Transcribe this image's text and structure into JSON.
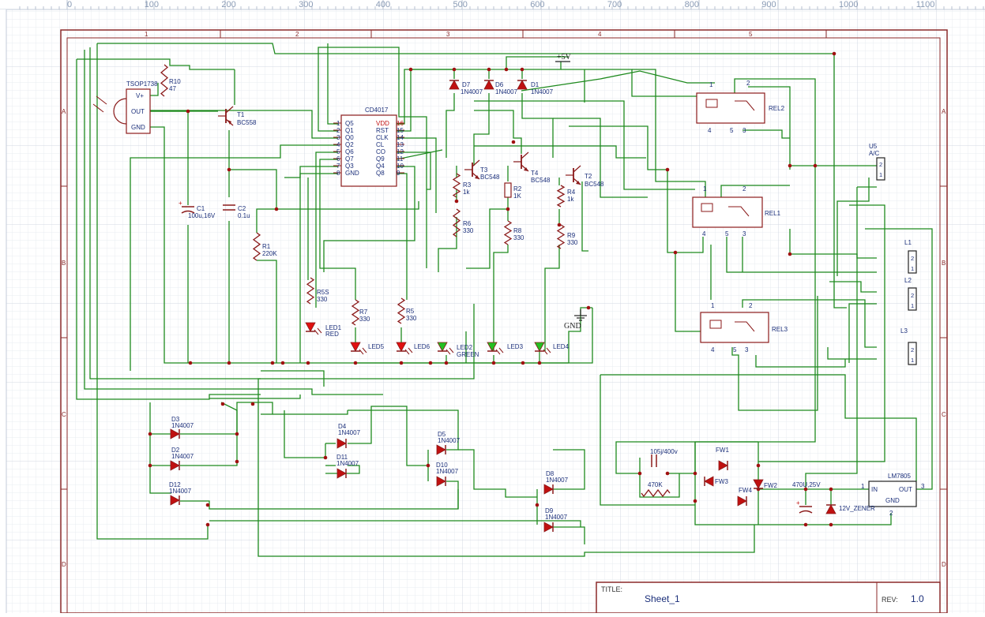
{
  "ruler": {
    "ticks": [
      "0",
      "100",
      "200",
      "300",
      "400",
      "500",
      "600",
      "700",
      "800",
      "900",
      "1000",
      "1100"
    ]
  },
  "frame": {
    "columns": [
      "1",
      "2",
      "3",
      "4",
      "5"
    ],
    "rows": [
      "A",
      "B",
      "C",
      "D"
    ]
  },
  "title_block": {
    "title_label": "TITLE:",
    "title_value": "Sheet_1",
    "rev_label": "REV:",
    "rev_value": "1.0"
  },
  "ic": {
    "name": "CD4017",
    "left_pins": [
      {
        "num": "1",
        "name": "Q5"
      },
      {
        "num": "2",
        "name": "Q1"
      },
      {
        "num": "3",
        "name": "Q0"
      },
      {
        "num": "4",
        "name": "Q2"
      },
      {
        "num": "5",
        "name": "Q6"
      },
      {
        "num": "6",
        "name": "Q7"
      },
      {
        "num": "7",
        "name": "Q3"
      },
      {
        "num": "8",
        "name": "GND"
      }
    ],
    "right_pins": [
      {
        "num": "16",
        "name": "VDD"
      },
      {
        "num": "15",
        "name": "RST"
      },
      {
        "num": "14",
        "name": "CLK"
      },
      {
        "num": "13",
        "name": "CL"
      },
      {
        "num": "12",
        "name": "CO"
      },
      {
        "num": "11",
        "name": "Q9"
      },
      {
        "num": "10",
        "name": "Q4"
      },
      {
        "num": "9",
        "name": "Q8"
      }
    ]
  },
  "tsop": {
    "name": "TSOP1738",
    "pins": [
      "V+",
      "OUT",
      "GND"
    ]
  },
  "regulator": {
    "name": "LM7805",
    "in_label": "IN",
    "out_label": "OUT",
    "gnd_label": "GND",
    "pin_in": "1",
    "pin_out": "3",
    "pin_gnd": "2"
  },
  "connectors": [
    {
      "ref": "U5",
      "sub": "A/C",
      "pins": [
        "2",
        "1"
      ]
    },
    {
      "ref": "L1",
      "sub": "",
      "pins": [
        "2",
        "1"
      ]
    },
    {
      "ref": "L2",
      "sub": "",
      "pins": [
        "2",
        "1"
      ]
    },
    {
      "ref": "L3",
      "sub": "",
      "pins": [
        "2",
        "1"
      ]
    }
  ],
  "relays": [
    {
      "ref": "REL2",
      "pins": [
        "1",
        "2",
        "4",
        "5",
        "3"
      ]
    },
    {
      "ref": "REL1",
      "pins": [
        "1",
        "2",
        "4",
        "5",
        "3"
      ]
    },
    {
      "ref": "REL3",
      "pins": [
        "1",
        "2",
        "4",
        "5",
        "3"
      ]
    }
  ],
  "transistors": [
    {
      "ref": "T1",
      "part": "BC558"
    },
    {
      "ref": "T3",
      "part": "BC548"
    },
    {
      "ref": "T4",
      "part": "BC548"
    },
    {
      "ref": "T2",
      "part": "BC548"
    }
  ],
  "resistors": [
    {
      "ref": "R10",
      "val": "47"
    },
    {
      "ref": "R1",
      "val": "220K"
    },
    {
      "ref": "R3",
      "val": "1k"
    },
    {
      "ref": "R6",
      "val": "330"
    },
    {
      "ref": "R2",
      "val": "1K"
    },
    {
      "ref": "R8",
      "val": "330"
    },
    {
      "ref": "R4",
      "val": "1k"
    },
    {
      "ref": "R9",
      "val": "330"
    },
    {
      "ref": "R5S",
      "val": "330"
    },
    {
      "ref": "R7",
      "val": "330"
    },
    {
      "ref": "R5",
      "val": "330"
    },
    {
      "ref": "",
      "val": "470K"
    }
  ],
  "capacitors": [
    {
      "ref": "C1",
      "val": "100u,16V"
    },
    {
      "ref": "C2",
      "val": "0.1u"
    },
    {
      "ref": "",
      "val": "105j/400v"
    },
    {
      "ref": "",
      "val": "470U,25V"
    }
  ],
  "leds": [
    {
      "ref": "LED1",
      "sub": "RED"
    },
    {
      "ref": "LED5",
      "sub": ""
    },
    {
      "ref": "LED6",
      "sub": ""
    },
    {
      "ref": "LED2",
      "sub": "GREEN"
    },
    {
      "ref": "LED3",
      "sub": ""
    },
    {
      "ref": "LED4",
      "sub": ""
    }
  ],
  "diodes": [
    {
      "ref": "D7",
      "part": "1N4007"
    },
    {
      "ref": "D6",
      "part": "1N4007"
    },
    {
      "ref": "D1",
      "part": "1N4007"
    },
    {
      "ref": "D3",
      "part": "1N4007"
    },
    {
      "ref": "D2",
      "part": "1N4007"
    },
    {
      "ref": "D12",
      "part": "1N4007"
    },
    {
      "ref": "D4",
      "part": "1N4007"
    },
    {
      "ref": "D11",
      "part": "1N4007"
    },
    {
      "ref": "D5",
      "part": "1N4007"
    },
    {
      "ref": "D10",
      "part": "1N4007"
    },
    {
      "ref": "D8",
      "part": "1N4007"
    },
    {
      "ref": "D9",
      "part": "1N4007"
    },
    {
      "ref": "FW1",
      "part": ""
    },
    {
      "ref": "FW3",
      "part": ""
    },
    {
      "ref": "FW4",
      "part": ""
    },
    {
      "ref": "FW2",
      "part": ""
    }
  ],
  "zener": {
    "val": "12V_ZENER"
  },
  "power": {
    "vcc": "+5V",
    "gnd": "GND"
  },
  "colors": {
    "wire": "#1e8a1e",
    "symbol": "#8b1a1a",
    "label": "#1b2f7a",
    "frame": "#8b2a2a",
    "grid": "#e3e8ef"
  }
}
